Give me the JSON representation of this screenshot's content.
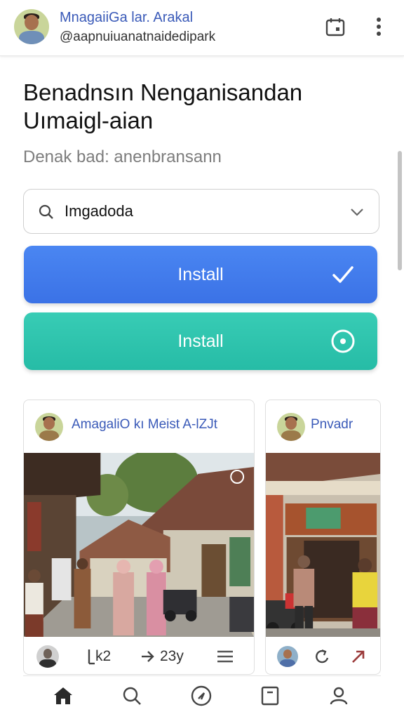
{
  "header": {
    "name": "MnagaiiGa lar. Arakal",
    "handle": "@aapnuiuanatnaidedipark",
    "icons": [
      "calendar-icon",
      "more-vertical-icon"
    ]
  },
  "page": {
    "title": "Benadnsın Nenganisandan Uımaigl-aian",
    "subtitle": "Denak bad: anenbransann"
  },
  "search": {
    "value": "Imgadoda",
    "icons": [
      "search-icon",
      "chevron-down-icon"
    ]
  },
  "buttons": [
    {
      "label": "Install",
      "color": "#3f78ea",
      "icon": "check-icon"
    },
    {
      "label": "Install",
      "color": "#2cc3ac",
      "icon": "radio-target-icon"
    }
  ],
  "cards": [
    {
      "title": "AmagaliO kı Meist A-lZJt",
      "image": "village-street-photo",
      "actions": [
        {
          "icon": "avatar-icon"
        },
        {
          "icon": "share-icon",
          "text": "k2"
        },
        {
          "icon": "arrow-right-icon",
          "text": "23y"
        },
        {
          "icon": "menu-icon"
        }
      ]
    },
    {
      "title": "Pnvadr",
      "image": "shop-front-photo",
      "actions": [
        {
          "icon": "avatar-icon"
        },
        {
          "icon": "refresh-icon"
        },
        {
          "icon": "arrow-up-right-icon"
        }
      ]
    }
  ],
  "bottom_nav": [
    {
      "icon": "home-icon",
      "active": true
    },
    {
      "icon": "search-icon"
    },
    {
      "icon": "compass-icon"
    },
    {
      "icon": "bookmark-icon"
    },
    {
      "icon": "profile-icon"
    }
  ],
  "colors": {
    "accent_blue": "#3f78ea",
    "accent_teal": "#2cc3ac",
    "link_blue": "#3a5ab8"
  }
}
